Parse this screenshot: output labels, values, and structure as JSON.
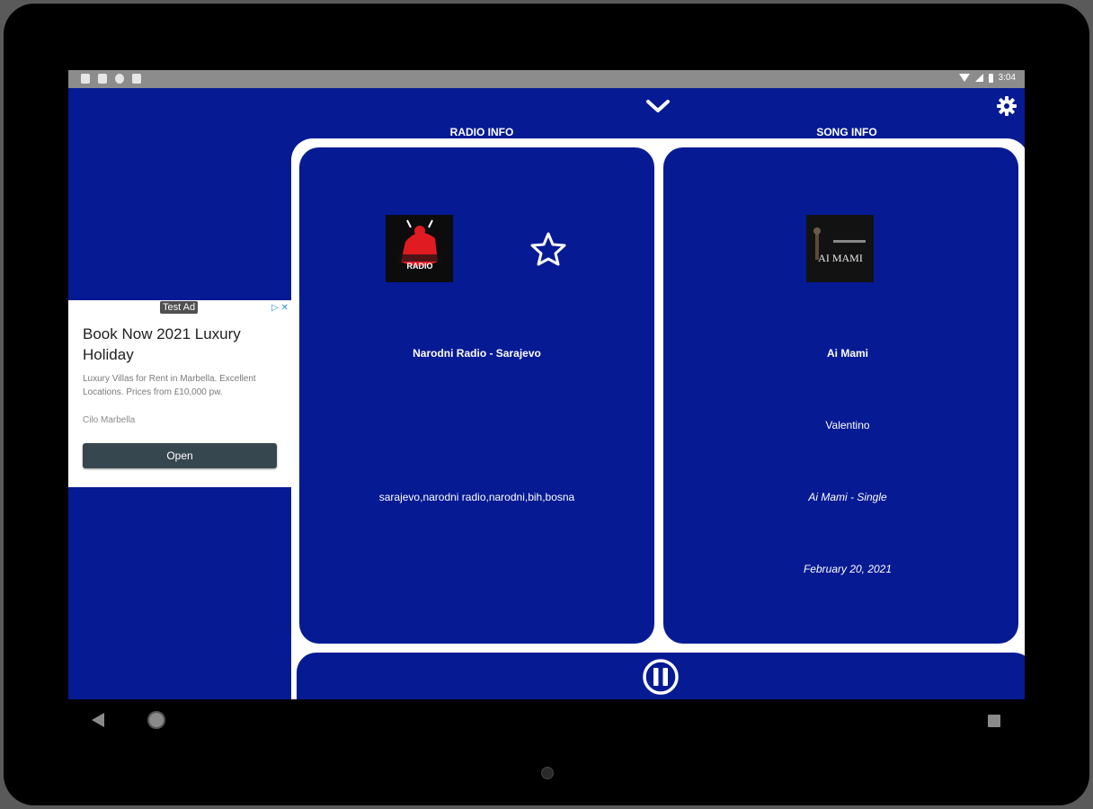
{
  "status_bar": {
    "time": "3:04"
  },
  "header": {
    "radio_info_label": "RADIO INFO",
    "song_info_label": "SONG INFO"
  },
  "radio": {
    "name": "Narodni Radio - Sarajevo",
    "tags": "sarajevo,narodni radio,narodni,bih,bosna",
    "logo_text": "RADIO"
  },
  "song": {
    "title": "Ai Mami",
    "artist": "Valentino",
    "album": "Ai Mami - Single",
    "date": "February 20, 2021",
    "cover_text": "AI MAMI"
  },
  "ad": {
    "tag": "Test Ad",
    "title": "Book Now 2021 Luxury Holiday",
    "body": "Luxury Villas for Rent in Marbella. Excellent Locations. Prices from £10,000 pw.",
    "sponsor": "Cilo Marbella",
    "cta": "Open"
  },
  "icons": {
    "collapse": "chevron-down-icon",
    "settings": "gear-icon",
    "favorite": "star-icon",
    "play_pause": "pause-icon"
  },
  "colors": {
    "background": "#061a93",
    "panel_border": "#ffffff",
    "ad_button": "#37474f"
  }
}
